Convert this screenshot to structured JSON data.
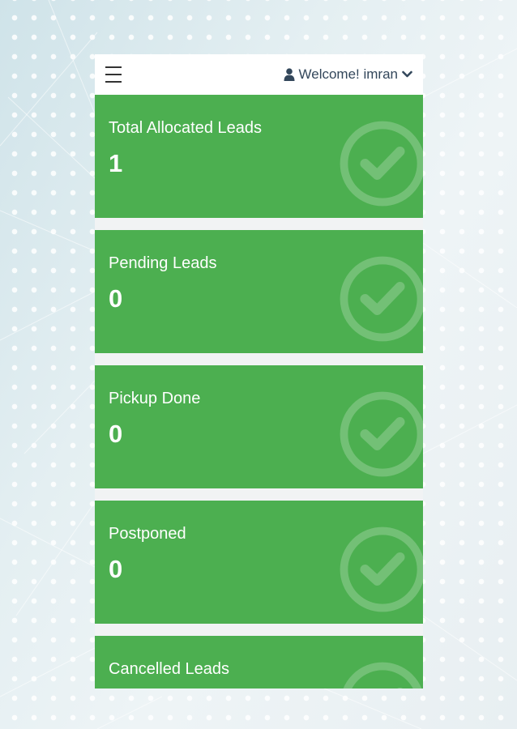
{
  "header": {
    "menu_icon": "hamburger-menu-icon",
    "user_icon": "user-icon",
    "welcome_text": "Welcome! imran",
    "dropdown_icon": "chevron-down-icon"
  },
  "colors": {
    "card_green": "#4caf50",
    "header_text": "#33475b",
    "header_bg": "#ffffff"
  },
  "cards": [
    {
      "title": "Total Allocated Leads",
      "count": "1",
      "icon": "check-circle-icon"
    },
    {
      "title": "Pending Leads",
      "count": "0",
      "icon": "check-circle-icon"
    },
    {
      "title": "Pickup Done",
      "count": "0",
      "icon": "check-circle-icon"
    },
    {
      "title": "Postponed",
      "count": "0",
      "icon": "check-circle-icon"
    },
    {
      "title": "Cancelled Leads",
      "count": "",
      "icon": "check-circle-icon"
    }
  ]
}
